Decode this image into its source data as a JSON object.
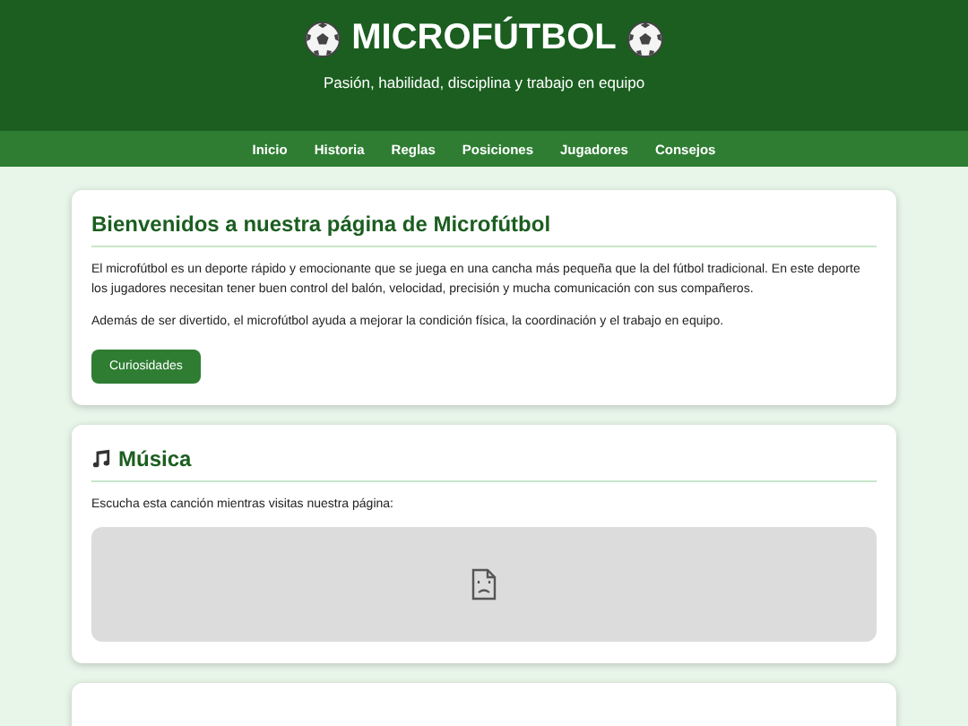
{
  "header": {
    "title": "MICROFÚTBOL",
    "subtitle": "Pasión, habilidad, disciplina y trabajo en equipo"
  },
  "nav": [
    "Inicio",
    "Historia",
    "Reglas",
    "Posiciones",
    "Jugadores",
    "Consejos"
  ],
  "welcome": {
    "heading": "Bienvenidos a nuestra página de Microfútbol",
    "paragraphs": [
      "El microfútbol es un deporte rápido y emocionante que se juega en una cancha más pequeña que la del fútbol tradicional. En este deporte los jugadores necesitan tener buen control del balón, velocidad, precisión y mucha comunicación con sus compañeros.",
      "Además de ser divertido, el microfútbol ayuda a mejorar la condición física, la coordinación y el trabajo en equipo."
    ],
    "button": "Curiosidades"
  },
  "music": {
    "heading": "Música",
    "text": "Escucha esta canción mientras visitas nuestra página:",
    "player": {
      "kind": "broken"
    }
  }
}
